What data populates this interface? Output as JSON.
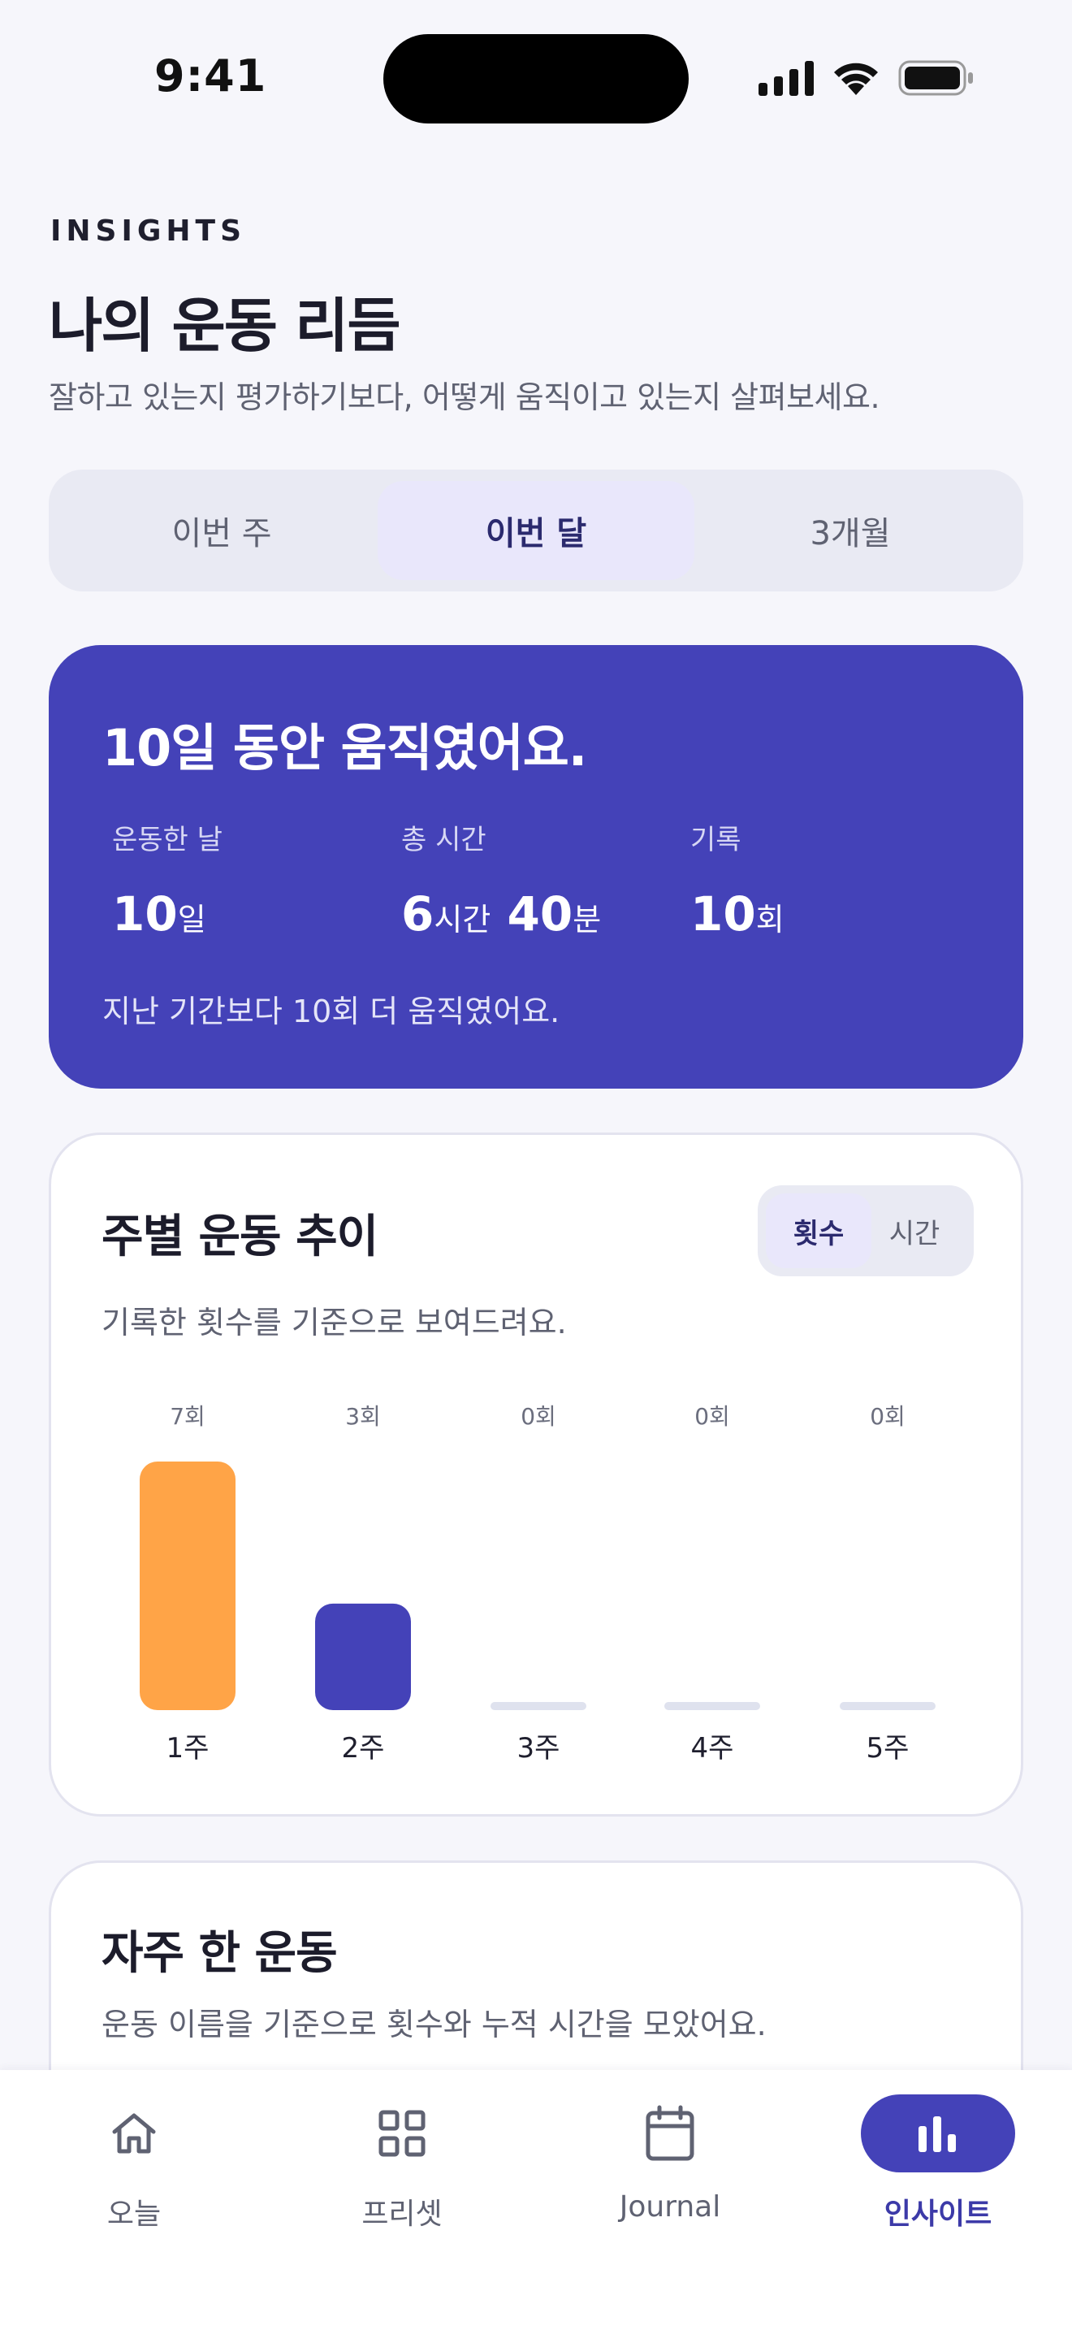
{
  "status_bar": {
    "time": "9:41"
  },
  "header": {
    "eyebrow": "INSIGHTS",
    "title": "나의 운동 리듬",
    "subtitle": "잘하고 있는지 평가하기보다, 어떻게 움직이고 있는지 살펴보세요."
  },
  "period_tabs": [
    {
      "label": "이번 주",
      "selected": false
    },
    {
      "label": "이번 달",
      "selected": true
    },
    {
      "label": "3개월",
      "selected": false
    }
  ],
  "summary": {
    "headline": "10일 동안 움직였어요.",
    "stats": [
      {
        "label": "운동한 날",
        "value": "10",
        "unit": "일"
      },
      {
        "label": "총 시간",
        "value_hours": "6",
        "unit_hours": "시간",
        "value_minutes": "40",
        "unit_minutes": "분"
      },
      {
        "label": "기록",
        "value": "10",
        "unit": "회"
      }
    ],
    "footer": "지난 기간보다 10회 더 움직였어요."
  },
  "weekly_trend": {
    "title": "주별 운동 추이",
    "description": "기록한 횟수를 기준으로 보여드려요.",
    "toggle": [
      {
        "label": "횟수",
        "selected": true
      },
      {
        "label": "시간",
        "selected": false
      }
    ]
  },
  "chart_data": {
    "type": "bar",
    "categories": [
      "1주",
      "2주",
      "3주",
      "4주",
      "5주"
    ],
    "values": [
      7,
      3,
      0,
      0,
      0
    ],
    "value_labels": [
      "7회",
      "3회",
      "0회",
      "0회",
      "0회"
    ],
    "bar_colors": [
      "#ffa447",
      "#4442b8",
      "#dfe2ee",
      "#dfe2ee",
      "#dfe2ee"
    ],
    "ylim": [
      0,
      7
    ],
    "grid": false
  },
  "frequent": {
    "title": "자주 한 운동",
    "description": "운동 이름을 기준으로 횟수와 누적 시간을 모았어요."
  },
  "tab_bar": [
    {
      "label": "오늘",
      "icon": "home-icon",
      "selected": false
    },
    {
      "label": "프리셋",
      "icon": "grid-icon",
      "selected": false
    },
    {
      "label": "Journal",
      "icon": "calendar-icon",
      "selected": false
    },
    {
      "label": "인사이트",
      "icon": "bar-chart-icon",
      "selected": true
    }
  ],
  "colors": {
    "accent": "#4442b8",
    "highlight_bar": "#ffa447",
    "background": "#f6f6fb"
  }
}
